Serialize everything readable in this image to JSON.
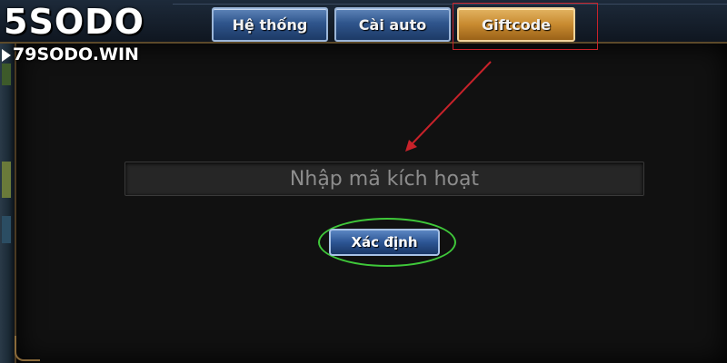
{
  "watermark": {
    "brand": "SODO",
    "brand_prefix": "5",
    "domain": "79SODO.WIN"
  },
  "tabs": [
    {
      "label": "Hệ thống",
      "active": false
    },
    {
      "label": "Cài auto",
      "active": false
    },
    {
      "label": "Giftcode",
      "active": true
    }
  ],
  "giftcode": {
    "input_value": "",
    "input_placeholder": "Nhập mã kích hoạt",
    "confirm_label": "Xác định"
  },
  "colors": {
    "active_tab": "#c88a30",
    "inactive_tab": "#2f558c",
    "highlight_red": "#c8222a",
    "highlight_green": "#3fc83a"
  }
}
